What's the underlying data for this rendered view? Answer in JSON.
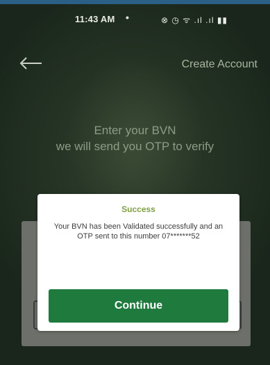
{
  "status_bar": {
    "time": "11:43 AM",
    "dot": "•",
    "icons_text": "⊗ ◷ ᯤ .ıl .ıl ▮▮",
    "icons": [
      "mute-icon",
      "alarm-icon",
      "wifi-icon",
      "signal-icon",
      "signal-icon",
      "battery-icon"
    ]
  },
  "header": {
    "back_icon": "arrow-left-icon",
    "title": "Create Account"
  },
  "instructions": {
    "line1": "Enter your BVN",
    "line2": "we will send you OTP to verify"
  },
  "dialog": {
    "title": "Success",
    "message": "Your BVN has been Validated successfully and an OTP sent to this number 07*******52",
    "button_label": "Continue"
  },
  "colors": {
    "accent": "#1f7a3e",
    "success_title": "#7fa045",
    "overlay_bg": "#243224"
  }
}
